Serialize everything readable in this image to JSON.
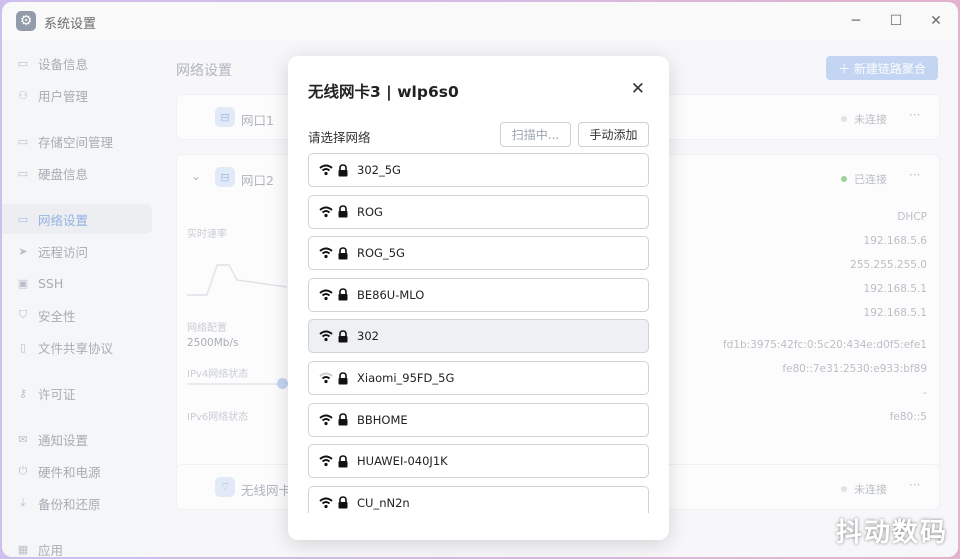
{
  "window": {
    "title": "系统设置",
    "minimize": "─",
    "maximize": "☐",
    "close": "✕"
  },
  "sidebar": {
    "items": [
      {
        "label": "设备信息",
        "icon": "drive-icon"
      },
      {
        "label": "用户管理",
        "icon": "users-icon"
      },
      {
        "label": "存储空间管理",
        "icon": "storage-icon"
      },
      {
        "label": "硬盘信息",
        "icon": "disk-icon"
      },
      {
        "label": "网络设置",
        "icon": "network-icon",
        "active": true
      },
      {
        "label": "远程访问",
        "icon": "send-icon"
      },
      {
        "label": "SSH",
        "icon": "terminal-icon"
      },
      {
        "label": "安全性",
        "icon": "shield-icon"
      },
      {
        "label": "文件共享协议",
        "icon": "file-icon"
      },
      {
        "label": "许可证",
        "icon": "key-icon"
      },
      {
        "label": "通知设置",
        "icon": "mail-icon"
      },
      {
        "label": "硬件和电源",
        "icon": "power-icon"
      },
      {
        "label": "备份和还原",
        "icon": "download-icon"
      },
      {
        "label": "应用",
        "icon": "apps-icon"
      }
    ]
  },
  "main": {
    "title": "网络设置",
    "new_button": "＋ 新建链路聚合",
    "port1": {
      "label": "网口1",
      "status": "未连接"
    },
    "port2": {
      "label": "网口2",
      "status": "已连接",
      "speed_label": "实时速率",
      "config_label": "网络配置",
      "config_value": "2500Mb/s",
      "ipv4_label": "IPv4网络状态",
      "ipv6_label": "IPv6网络状态",
      "values": [
        "DHCP",
        "192.168.5.6",
        "255.255.255.0",
        "192.168.5.1",
        "192.168.5.1",
        "fd1b:3975:42fc:0:5c20:434e:d0f5:efe1",
        "fe80::7e31:2530:e933:bf89",
        "-",
        "fe80::5"
      ]
    },
    "wireless": {
      "label": "无线网卡",
      "status": "未连接"
    },
    "more": "···"
  },
  "dialog": {
    "title": "无线网卡3 | wlp6s0",
    "close": "✕",
    "subtitle": "请选择网络",
    "scan_button": "扫描中...",
    "add_button": "手动添加",
    "networks": [
      {
        "name": "302_5G",
        "signal": "strong"
      },
      {
        "name": "ROG",
        "signal": "strong"
      },
      {
        "name": "ROG_5G",
        "signal": "strong"
      },
      {
        "name": "BE86U-MLO",
        "signal": "strong"
      },
      {
        "name": "302",
        "signal": "strong",
        "hover": true
      },
      {
        "name": "Xiaomi_95FD_5G",
        "signal": "medium"
      },
      {
        "name": "BBHOME",
        "signal": "strong"
      },
      {
        "name": "HUAWEI-040J1K",
        "signal": "strong"
      },
      {
        "name": "CU_nN2n",
        "signal": "strong"
      }
    ]
  },
  "watermark": "抖动数码",
  "colors": {
    "accent": "#5f8fd8",
    "connected": "#6cc46a",
    "disconnected": "#c9ced5"
  }
}
